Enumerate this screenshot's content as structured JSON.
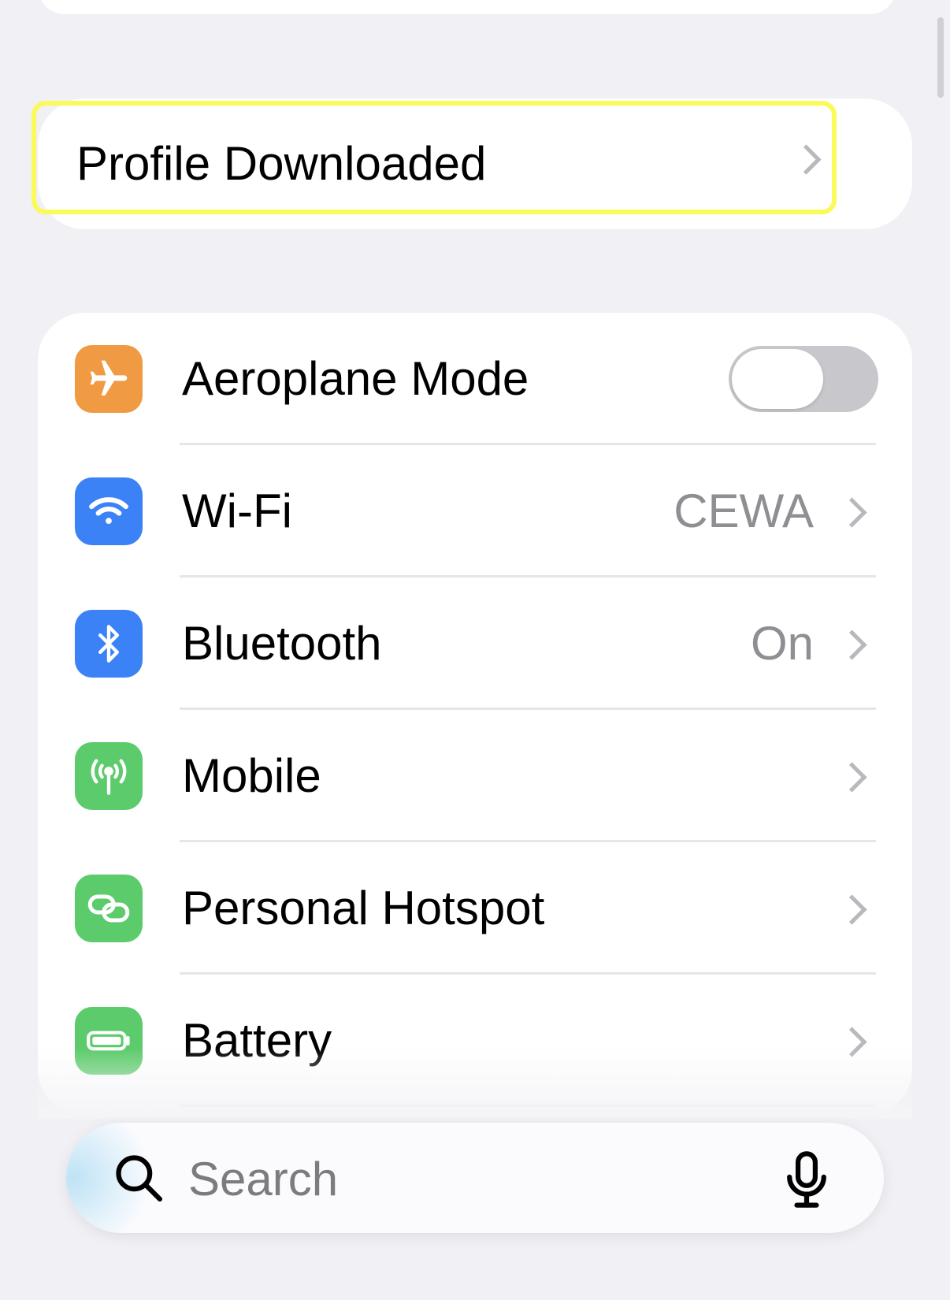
{
  "profile": {
    "label": "Profile Downloaded"
  },
  "settings": {
    "rows": [
      {
        "label": "Aeroplane Mode",
        "icon": "airplane-icon",
        "color": "#f09a43",
        "toggle": false
      },
      {
        "label": "Wi-Fi",
        "icon": "wifi-icon",
        "color": "#3b82f6",
        "value": "CEWA"
      },
      {
        "label": "Bluetooth",
        "icon": "bluetooth-icon",
        "color": "#3b82f6",
        "value": "On"
      },
      {
        "label": "Mobile",
        "icon": "antenna-icon",
        "color": "#5ccb6b"
      },
      {
        "label": "Personal Hotspot",
        "icon": "link-icon",
        "color": "#5ccb6b"
      },
      {
        "label": "Battery",
        "icon": "battery-icon",
        "color": "#5ccb6b"
      }
    ]
  },
  "search": {
    "placeholder": "Search"
  },
  "colors": {
    "accent_highlight": "#fafa5a",
    "toggle_off": "#c7c7cc",
    "secondary_text": "#8e8e93"
  }
}
